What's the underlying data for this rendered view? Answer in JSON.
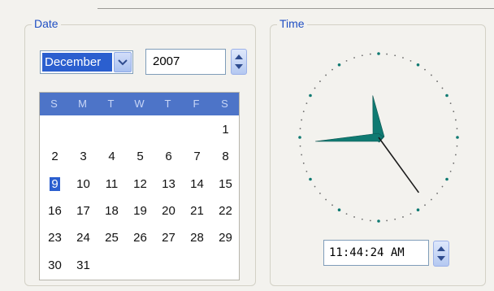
{
  "date": {
    "legend": "Date",
    "month": "December",
    "year": "2007",
    "weekdays": [
      "S",
      "M",
      "T",
      "W",
      "T",
      "F",
      "S"
    ],
    "weeks": [
      [
        "",
        "",
        "",
        "",
        "",
        "",
        "1"
      ],
      [
        "2",
        "3",
        "4",
        "5",
        "6",
        "7",
        "8"
      ],
      [
        "9",
        "10",
        "11",
        "12",
        "13",
        "14",
        "15"
      ],
      [
        "16",
        "17",
        "18",
        "19",
        "20",
        "21",
        "22"
      ],
      [
        "23",
        "24",
        "25",
        "26",
        "27",
        "28",
        "29"
      ],
      [
        "30",
        "31",
        "",
        "",
        "",
        "",
        ""
      ]
    ],
    "selected_day": "9"
  },
  "time": {
    "legend": "Time",
    "value": "11:44:24 AM",
    "clock": {
      "hour": 11,
      "minute": 44,
      "second": 24
    }
  },
  "colors": {
    "accent": "#2b5fcf",
    "header": "#4d74c8",
    "hand": "#0f7a72"
  }
}
